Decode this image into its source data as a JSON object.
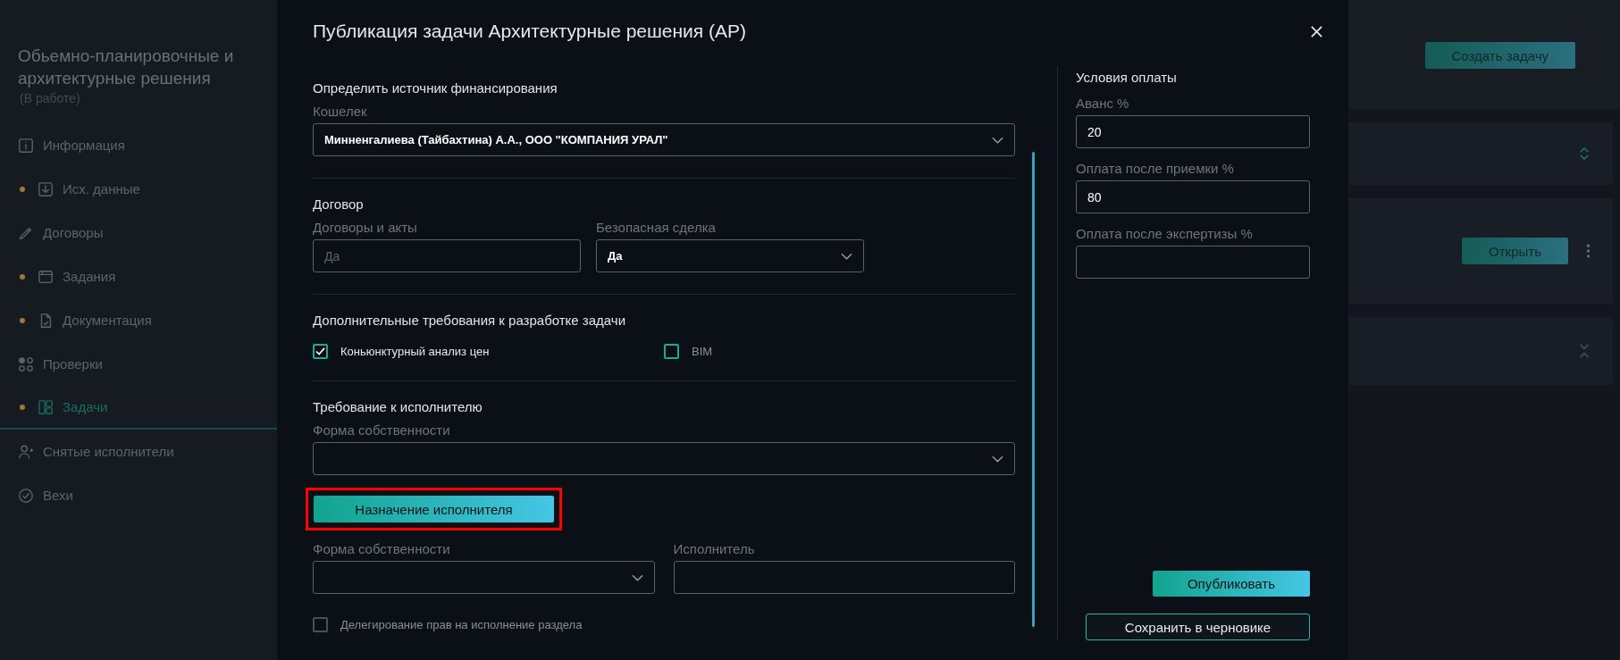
{
  "sidebar": {
    "title": "Обьемно-планировочные и архитектурные решения",
    "status": "(В работе)",
    "items": [
      {
        "kind": "info",
        "label": "Информация",
        "dot": false,
        "selected": false
      },
      {
        "kind": "import",
        "label": "Исх. данные",
        "dot": true,
        "selected": false
      },
      {
        "kind": "contract",
        "label": "Договоры",
        "dot": false,
        "selected": false
      },
      {
        "kind": "tasks",
        "label": "Задания",
        "dot": true,
        "selected": false
      },
      {
        "kind": "document",
        "label": "Документация",
        "dot": true,
        "selected": false
      },
      {
        "kind": "checks",
        "label": "Проверки",
        "dot": false,
        "selected": false
      },
      {
        "kind": "board",
        "label": "Задачи",
        "dot": true,
        "selected": true
      },
      {
        "kind": "users",
        "label": "Снятые исполнители",
        "dot": false,
        "selected": false
      },
      {
        "kind": "milestone",
        "label": "Вехи",
        "dot": false,
        "selected": false
      }
    ]
  },
  "dialog": {
    "title": "Публикация задачи Архитектурные решения (АР)",
    "funding": {
      "heading": "Определить источник финансирования",
      "wallet_label": "Кошелек",
      "wallet_value": "Минненгалиева (Тайбахтина) А.А., ООО \"КОМПАНИЯ УРАЛ\""
    },
    "contract": {
      "heading": "Договор",
      "docs_label": "Договоры и акты",
      "docs_placeholder": "Да",
      "safe_deal_label": "Безопасная сделка",
      "safe_deal_value": "Да"
    },
    "requirements": {
      "heading": "Дополнительные требования к разработке задачи",
      "options": [
        {
          "label": "Коньюнктурный анализ цен",
          "checked": true
        },
        {
          "label": "BIM",
          "checked": false
        }
      ]
    },
    "executor": {
      "heading": "Требование к исполнителю",
      "ownership_label": "Форма собственности",
      "assign_button": {
        "label": "Назначение исполнителя",
        "highlighted": true
      },
      "ownership_label_2": "Форма собственности",
      "executor_label": "Исполнитель",
      "delegation": {
        "label": "Делегирование прав на исполнение раздела",
        "checked": false
      }
    },
    "payment": {
      "heading": "Условия оплаты",
      "fields": [
        {
          "label": "Аванс %",
          "value": "20"
        },
        {
          "label": "Оплата после приемки %",
          "value": "80"
        },
        {
          "label": "Оплата после экспертизы %"
        }
      ]
    },
    "publish_button": "Опубликовать",
    "draft_button": "Сохранить в черновике"
  },
  "background": {
    "create_button": "Создать задачу",
    "open_button": "Открыть"
  }
}
